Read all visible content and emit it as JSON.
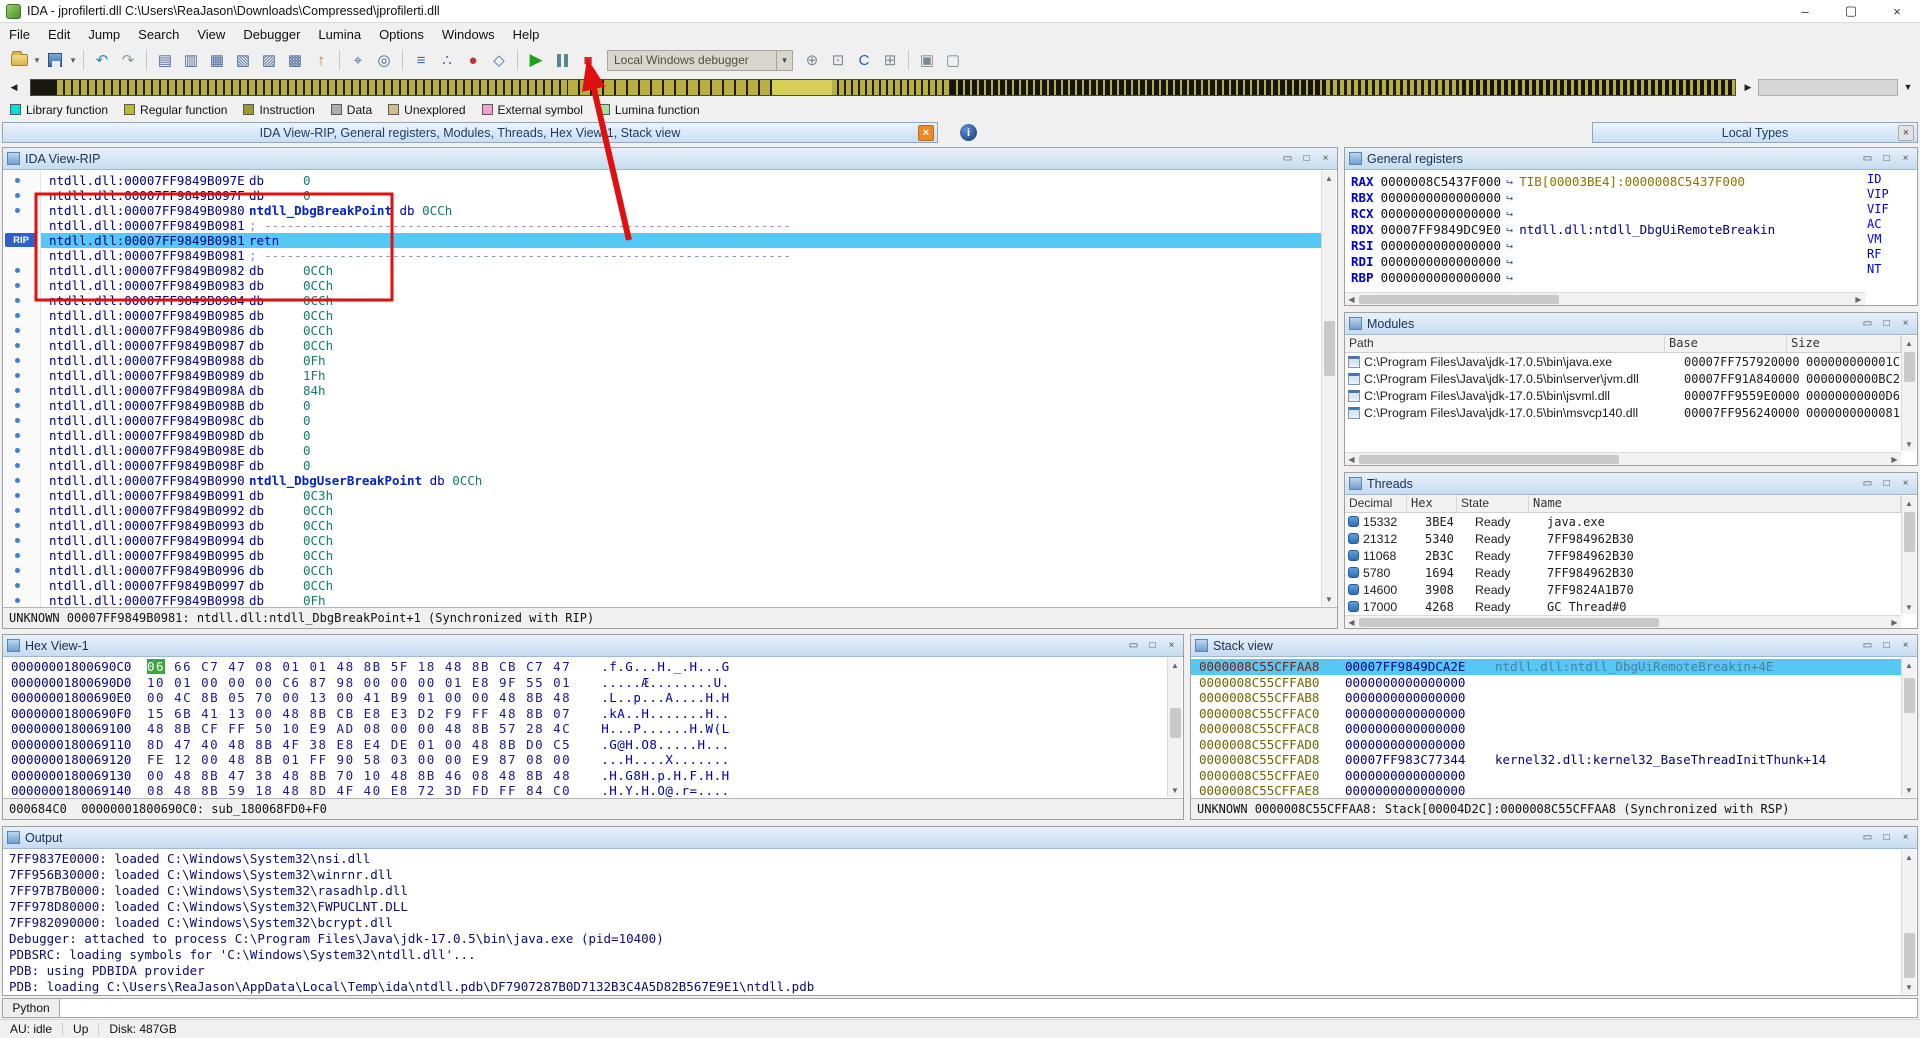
{
  "titlebar": {
    "title": "IDA - jprofilerti.dll C:\\Users\\ReaJason\\Downloads\\Compressed\\jprofilerti.dll"
  },
  "menu": {
    "items": [
      "File",
      "Edit",
      "Jump",
      "Search",
      "View",
      "Debugger",
      "Lumina",
      "Options",
      "Windows",
      "Help"
    ]
  },
  "toolbar": {
    "debugger_selector": "Local Windows debugger",
    "icons": [
      {
        "name": "open-file-icon",
        "type": "folder"
      },
      {
        "name": "open-file-caret",
        "type": "caret"
      },
      {
        "name": "save-file-icon",
        "type": "disk"
      },
      {
        "name": "save-file-caret",
        "type": "caret"
      },
      {
        "type": "sep"
      },
      {
        "name": "undo-icon",
        "glyph": "↶",
        "color": "#2E8BB0"
      },
      {
        "name": "redo-icon",
        "glyph": "↷",
        "color": "#8C98A4"
      },
      {
        "type": "sep"
      },
      {
        "name": "open-ida-view-icon",
        "glyph": "▤",
        "color": "#47699B"
      },
      {
        "name": "open-hex-view-icon",
        "glyph": "▥",
        "color": "#47699B"
      },
      {
        "name": "open-structures-icon",
        "glyph": "▦",
        "color": "#47699B"
      },
      {
        "name": "open-enums-icon",
        "glyph": "▧",
        "color": "#47699B"
      },
      {
        "name": "open-imports-icon",
        "glyph": "▨",
        "color": "#47699B"
      },
      {
        "name": "open-exports-icon",
        "glyph": "▩",
        "color": "#47699B"
      },
      {
        "name": "jump-address-icon",
        "glyph": "↑",
        "color": "#C07820"
      },
      {
        "type": "sep"
      },
      {
        "name": "search-icon",
        "glyph": "⌖",
        "color": "#47699B"
      },
      {
        "name": "search-again-icon",
        "glyph": "◎",
        "color": "#47699B"
      },
      {
        "type": "sep"
      },
      {
        "name": "flow-chart-icon",
        "glyph": "≡",
        "color": "#47699B"
      },
      {
        "name": "function-calls-icon",
        "glyph": "∴",
        "color": "#47699B"
      },
      {
        "name": "breakpoint-list-icon",
        "glyph": "●",
        "color": "#C23535"
      },
      {
        "name": "watches-icon",
        "glyph": "◇",
        "color": "#47699B"
      },
      {
        "type": "sep"
      },
      {
        "name": "continue-process-icon",
        "type": "play"
      },
      {
        "name": "pause-process-icon",
        "type": "pause"
      },
      {
        "name": "stop-process-icon",
        "type": "stop"
      },
      {
        "name": "debugger-selector",
        "type": "combo"
      },
      {
        "name": "attach-process-icon",
        "glyph": "⊕",
        "color": "#7C8890"
      },
      {
        "name": "debugger-options-icon",
        "glyph": "⊡",
        "color": "#7C8890"
      },
      {
        "name": "decompiler-icon",
        "glyph": "C",
        "color": "#2C5FA8"
      },
      {
        "name": "quick-view-icon",
        "glyph": "⊞",
        "color": "#7C8890"
      },
      {
        "type": "sep"
      },
      {
        "name": "desktop-layout-icon",
        "glyph": "▣",
        "color": "#7C8890"
      },
      {
        "name": "windows-list-icon",
        "glyph": "▢",
        "color": "#7C8890"
      }
    ]
  },
  "legend": {
    "items": [
      {
        "label": "Library function",
        "color": "#00DDDD"
      },
      {
        "label": "Regular function",
        "color": "#B8B83C"
      },
      {
        "label": "Instruction",
        "color": "#9A9A30"
      },
      {
        "label": "Data",
        "color": "#ADADAD"
      },
      {
        "label": "Unexplored",
        "color": "#CDBE8C"
      },
      {
        "label": "External symbol",
        "color": "#F2A0CE"
      },
      {
        "label": "Lumina function",
        "color": "#9FE09F"
      }
    ]
  },
  "captions": {
    "main_group": "IDA View-RIP, General registers, Modules, Threads, Hex View-1, Stack view",
    "local_types": "Local Types"
  },
  "disasm": {
    "title": "IDA View-RIP",
    "rip_label": "RIP",
    "sep_comment": "; ----------------------------------------------------------------------",
    "status": "UNKNOWN 00007FF9849B0981: ntdll.dll:ntdll_DbgBreakPoint+1 (Synchronized with RIP)",
    "lines": [
      {
        "addr": "ntdll.dll:00007FF9849B097E",
        "kind": "data",
        "mnem": "db",
        "op": "0"
      },
      {
        "addr": "ntdll.dll:00007FF9849B097F",
        "kind": "data",
        "mnem": "db",
        "op": "0"
      },
      {
        "addr": "ntdll.dll:00007FF9849B0980",
        "kind": "data",
        "name": "ntdll_DbgBreakPoint",
        "mnem": "db",
        "op": "0CCh"
      },
      {
        "addr": "ntdll.dll:00007FF9849B0981",
        "kind": "sep"
      },
      {
        "addr": "ntdll.dll:00007FF9849B0981",
        "kind": "code",
        "mnem": "retn",
        "rip": true
      },
      {
        "addr": "ntdll.dll:00007FF9849B0981",
        "kind": "sep"
      },
      {
        "addr": "ntdll.dll:00007FF9849B0982",
        "kind": "data",
        "mnem": "db",
        "op": "0CCh"
      },
      {
        "addr": "ntdll.dll:00007FF9849B0983",
        "kind": "data",
        "mnem": "db",
        "op": "0CCh"
      },
      {
        "addr": "ntdll.dll:00007FF9849B0984",
        "kind": "data",
        "mnem": "db",
        "op": "0CCh"
      },
      {
        "addr": "ntdll.dll:00007FF9849B0985",
        "kind": "data",
        "mnem": "db",
        "op": "0CCh"
      },
      {
        "addr": "ntdll.dll:00007FF9849B0986",
        "kind": "data",
        "mnem": "db",
        "op": "0CCh"
      },
      {
        "addr": "ntdll.dll:00007FF9849B0987",
        "kind": "data",
        "mnem": "db",
        "op": "0CCh"
      },
      {
        "addr": "ntdll.dll:00007FF9849B0988",
        "kind": "data",
        "mnem": "db",
        "op": "0Fh"
      },
      {
        "addr": "ntdll.dll:00007FF9849B0989",
        "kind": "data",
        "mnem": "db",
        "op": "1Fh"
      },
      {
        "addr": "ntdll.dll:00007FF9849B098A",
        "kind": "data",
        "mnem": "db",
        "op": "84h"
      },
      {
        "addr": "ntdll.dll:00007FF9849B098B",
        "kind": "data",
        "mnem": "db",
        "op": "0"
      },
      {
        "addr": "ntdll.dll:00007FF9849B098C",
        "kind": "data",
        "mnem": "db",
        "op": "0"
      },
      {
        "addr": "ntdll.dll:00007FF9849B098D",
        "kind": "data",
        "mnem": "db",
        "op": "0"
      },
      {
        "addr": "ntdll.dll:00007FF9849B098E",
        "kind": "data",
        "mnem": "db",
        "op": "0"
      },
      {
        "addr": "ntdll.dll:00007FF9849B098F",
        "kind": "data",
        "mnem": "db",
        "op": "0"
      },
      {
        "addr": "ntdll.dll:00007FF9849B0990",
        "kind": "data",
        "name": "ntdll_DbgUserBreakPoint",
        "mnem": "db",
        "op": "0CCh"
      },
      {
        "addr": "ntdll.dll:00007FF9849B0991",
        "kind": "data",
        "mnem": "db",
        "op": "0C3h"
      },
      {
        "addr": "ntdll.dll:00007FF9849B0992",
        "kind": "data",
        "mnem": "db",
        "op": "0CCh"
      },
      {
        "addr": "ntdll.dll:00007FF9849B0993",
        "kind": "data",
        "mnem": "db",
        "op": "0CCh"
      },
      {
        "addr": "ntdll.dll:00007FF9849B0994",
        "kind": "data",
        "mnem": "db",
        "op": "0CCh"
      },
      {
        "addr": "ntdll.dll:00007FF9849B0995",
        "kind": "data",
        "mnem": "db",
        "op": "0CCh"
      },
      {
        "addr": "ntdll.dll:00007FF9849B0996",
        "kind": "data",
        "mnem": "db",
        "op": "0CCh"
      },
      {
        "addr": "ntdll.dll:00007FF9849B0997",
        "kind": "data",
        "mnem": "db",
        "op": "0CCh"
      },
      {
        "addr": "ntdll.dll:00007FF9849B0998",
        "kind": "data",
        "mnem": "db",
        "op": "0Fh"
      }
    ]
  },
  "registers": {
    "title": "General registers",
    "rows": [
      {
        "name": "RAX",
        "value": "0000008C5437F000",
        "ann": "TIB[00003BE4]:0000008C5437F000",
        "ann_kind": "tib"
      },
      {
        "name": "RBX",
        "value": "0000000000000000",
        "ann": "",
        "ann_kind": ""
      },
      {
        "name": "RCX",
        "value": "0000000000000000",
        "ann": "",
        "ann_kind": ""
      },
      {
        "name": "RDX",
        "value": "00007FF9849DC9E0",
        "ann": "ntdll.dll:ntdll_DbgUiRemoteBreakin",
        "ann_kind": "sym"
      },
      {
        "name": "RSI",
        "value": "0000000000000000",
        "ann": "",
        "ann_kind": ""
      },
      {
        "name": "RDI",
        "value": "0000000000000000",
        "ann": "",
        "ann_kind": ""
      },
      {
        "name": "RBP",
        "value": "0000000000000000",
        "ann": "",
        "ann_kind": ""
      }
    ],
    "flags": [
      "ID",
      "VIP",
      "VIF",
      "AC",
      "VM",
      "RF",
      "NT"
    ]
  },
  "modules": {
    "title": "Modules",
    "columns": [
      "Path",
      "Base",
      "Size"
    ],
    "rows": [
      {
        "path": "C:\\Program Files\\Java\\jdk-17.0.5\\bin\\java.exe",
        "base": "00007FF757920000",
        "size": "000000000001C"
      },
      {
        "path": "C:\\Program Files\\Java\\jdk-17.0.5\\bin\\server\\jvm.dll",
        "base": "00007FF91A840000",
        "size": "0000000000BC2"
      },
      {
        "path": "C:\\Program Files\\Java\\jdk-17.0.5\\bin\\jsvml.dll",
        "base": "00007FF9559E0000",
        "size": "00000000000D6"
      },
      {
        "path": "C:\\Program Files\\Java\\jdk-17.0.5\\bin\\msvcp140.dll",
        "base": "00007FF956240000",
        "size": "0000000000081"
      }
    ]
  },
  "threads": {
    "title": "Threads",
    "columns": [
      "Decimal",
      "Hex",
      "State",
      "Name"
    ],
    "rows": [
      {
        "decimal": "15332",
        "hex": "3BE4",
        "state": "Ready",
        "thread_name": "java.exe"
      },
      {
        "decimal": "21312",
        "hex": "5340",
        "state": "Ready",
        "thread_name": "7FF984962B30"
      },
      {
        "decimal": "11068",
        "hex": "2B3C",
        "state": "Ready",
        "thread_name": "7FF984962B30"
      },
      {
        "decimal": "5780",
        "hex": "1694",
        "state": "Ready",
        "thread_name": "7FF984962B30"
      },
      {
        "decimal": "14600",
        "hex": "3908",
        "state": "Ready",
        "thread_name": "7FF9824A1B70"
      },
      {
        "decimal": "17000",
        "hex": "4268",
        "state": "Ready",
        "thread_name": "GC Thread#0"
      }
    ]
  },
  "hex": {
    "title": "Hex View-1",
    "status": "000684C0  00000001800690C0: sub_180068FD0+F0",
    "rows": [
      {
        "addr": "00000001800690C0",
        "bytes": "06 66 C7 47 08 01 01 48 8B 5F 18 48 8B CB C7 47",
        "ascii": ".f.G...H._.H...G",
        "hl": true
      },
      {
        "addr": "00000001800690D0",
        "bytes": "10 01 00 00 00 C6 87 98 00 00 00 01 E8 9F 55 01",
        "ascii": ".....Æ........U.",
        "hl": false
      },
      {
        "addr": "00000001800690E0",
        "bytes": "00 4C 8B 05 70 00 13 00 41 B9 01 00 00 48 8B 48",
        "ascii": ".L..p...A....H.H",
        "hl": false
      },
      {
        "addr": "00000001800690F0",
        "bytes": "15 6B 41 13 00 48 8B CB E8 E3 D2 F9 FF 48 8B 07",
        "ascii": ".kA..H.......H..",
        "hl": false
      },
      {
        "addr": "0000000180069100",
        "bytes": "48 8B CF FF 50 10 E9 AD 08 00 00 48 8B 57 28 4C",
        "ascii": "H...P......H.W(L",
        "hl": false
      },
      {
        "addr": "0000000180069110",
        "bytes": "8D 47 40 48 8B 4F 38 E8 E4 DE 01 00 48 8B D0 C5",
        "ascii": ".G@H.O8.....H...",
        "hl": false
      },
      {
        "addr": "0000000180069120",
        "bytes": "FE 12 00 48 8B 01 FF 90 58 03 00 00 E9 87 08 00",
        "ascii": "...H....X.......",
        "hl": false
      },
      {
        "addr": "0000000180069130",
        "bytes": "00 48 8B 47 38 48 8B 70 10 48 8B 46 08 48 8B 48",
        "ascii": ".H.G8H.p.H.F.H.H",
        "hl": false
      },
      {
        "addr": "0000000180069140",
        "bytes": "08 48 8B 59 18 48 8D 4F 40 E8 72 3D FD FF 84 C0",
        "ascii": ".H.Y.H.O@.r=....",
        "hl": false
      }
    ]
  },
  "stack": {
    "title": "Stack view",
    "status": "UNKNOWN 0000008C55CFFAA8: Stack[00004D2C]:0000008C55CFFAA8 (Synchronized with RSP)",
    "rows": [
      {
        "addr": "0000008C55CFFAA8",
        "value": "00007FF9849DCA2E",
        "sym": "ntdll.dll:ntdll_DbgUiRemoteBreakin+4E",
        "hl": true,
        "cur": true
      },
      {
        "addr": "0000008C55CFFAB0",
        "value": "0000000000000000",
        "sym": "",
        "hl": false,
        "cur": false
      },
      {
        "addr": "0000008C55CFFAB8",
        "value": "0000000000000000",
        "sym": "",
        "hl": false,
        "cur": false
      },
      {
        "addr": "0000008C55CFFAC0",
        "value": "0000000000000000",
        "sym": "",
        "hl": false,
        "cur": false
      },
      {
        "addr": "0000008C55CFFAC8",
        "value": "0000000000000000",
        "sym": "",
        "hl": false,
        "cur": false
      },
      {
        "addr": "0000008C55CFFAD0",
        "value": "0000000000000000",
        "sym": "",
        "hl": false,
        "cur": false
      },
      {
        "addr": "0000008C55CFFAD8",
        "value": "00007FF983C77344",
        "sym": "kernel32.dll:kernel32_BaseThreadInitThunk+14",
        "hl": false,
        "cur": false
      },
      {
        "addr": "0000008C55CFFAE0",
        "value": "0000000000000000",
        "sym": "",
        "hl": false,
        "cur": false
      },
      {
        "addr": "0000008C55CFFAE8",
        "value": "0000000000000000",
        "sym": "",
        "hl": false,
        "cur": false
      }
    ]
  },
  "output": {
    "title": "Output",
    "python_label": "Python",
    "lines": [
      "7FF9837E0000: loaded C:\\Windows\\System32\\nsi.dll",
      "7FF956B30000: loaded C:\\Windows\\System32\\winrnr.dll",
      "7FF97B7B0000: loaded C:\\Windows\\System32\\rasadhlp.dll",
      "7FF978D80000: loaded C:\\Windows\\System32\\FWPUCLNT.DLL",
      "7FF982090000: loaded C:\\Windows\\System32\\bcrypt.dll",
      "Debugger: attached to process C:\\Program Files\\Java\\jdk-17.0.5\\bin\\java.exe (pid=10400)",
      "PDBSRC: loading symbols for 'C:\\Windows\\System32\\ntdll.dll'...",
      "PDB: using PDBIDA provider",
      "PDB: loading C:\\Users\\ReaJason\\AppData\\Local\\Temp\\ida\\ntdll.pdb\\DF7907287B0D7132B3C4A5D82B567E9E1\\ntdll.pdb"
    ]
  },
  "statusbar": {
    "au": "AU: idle",
    "up": "Up",
    "disk": "Disk: 487GB"
  }
}
